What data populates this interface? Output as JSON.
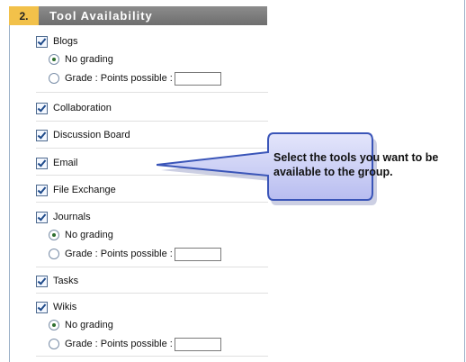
{
  "section": {
    "number": "2.",
    "title": "Tool Availability"
  },
  "tools": [
    {
      "label": "Blogs",
      "checked": true,
      "grading": {
        "no_grading": "No grading",
        "grade_label": "Grade : Points possible :",
        "selected": "no_grading",
        "points": ""
      }
    },
    {
      "label": "Collaboration",
      "checked": true
    },
    {
      "label": "Discussion Board",
      "checked": true
    },
    {
      "label": "Email",
      "checked": true
    },
    {
      "label": "File Exchange",
      "checked": true
    },
    {
      "label": "Journals",
      "checked": true,
      "grading": {
        "no_grading": "No grading",
        "grade_label": "Grade : Points possible :",
        "selected": "no_grading",
        "points": ""
      }
    },
    {
      "label": "Tasks",
      "checked": true
    },
    {
      "label": "Wikis",
      "checked": true,
      "grading": {
        "no_grading": "No grading",
        "grade_label": "Grade : Points possible :",
        "selected": "no_grading",
        "points": ""
      }
    }
  ],
  "callout": {
    "text": "Select the tools you want to be available to the group."
  },
  "colors": {
    "step_box": "#f2c14a",
    "section_bar": "#7a7a7a",
    "callout_fill": "#c9ccf4",
    "callout_border": "#3a55b8"
  }
}
